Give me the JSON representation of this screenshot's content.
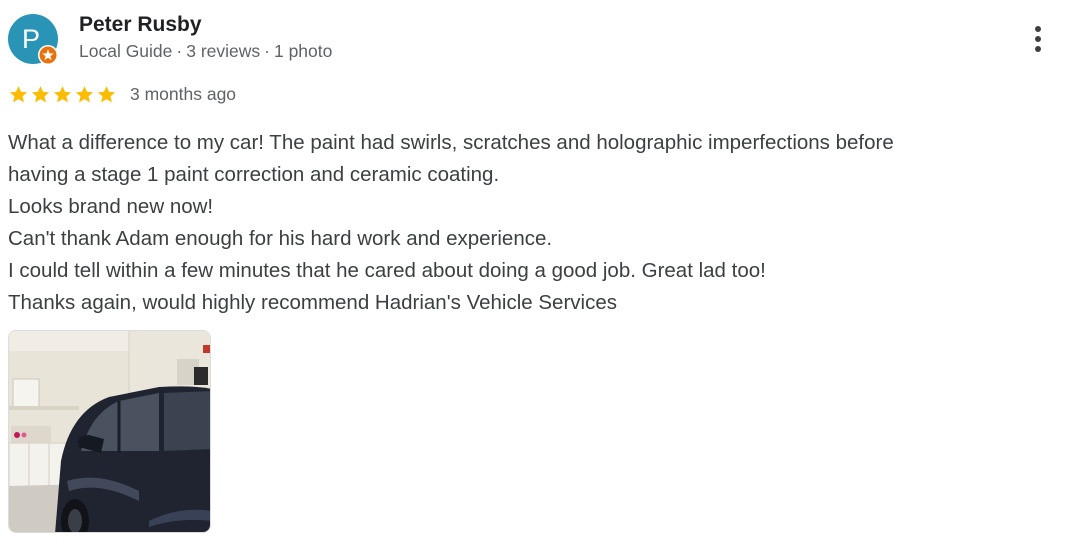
{
  "review": {
    "author": {
      "initial": "P",
      "name": "Peter Rusby",
      "badge": "Local Guide",
      "reviews": "3 reviews",
      "photos": "1 photo",
      "avatar_color": "#2a94b6",
      "badge_color": "#e8710a",
      "badge_icon": "local-guide-star-icon"
    },
    "menu_icon": "more-vert-icon",
    "rating": {
      "stars": 5,
      "max": 5,
      "star_color": "#fbbc04"
    },
    "time": "3 months ago",
    "text_lines": [
      "What a difference to my car! The paint had swirls, scratches and holographic imperfections before",
      "having a stage 1 paint correction and ceramic coating.",
      "Looks brand new now!",
      "Can't thank Adam enough for his hard work and experience.",
      "I could tell within a few minutes that he cared about doing a good job. Great lad too!",
      "Thanks again, would highly recommend Hadrian's Vehicle Services"
    ],
    "photos": [
      {
        "subject": "car-in-garage-photo"
      }
    ]
  }
}
